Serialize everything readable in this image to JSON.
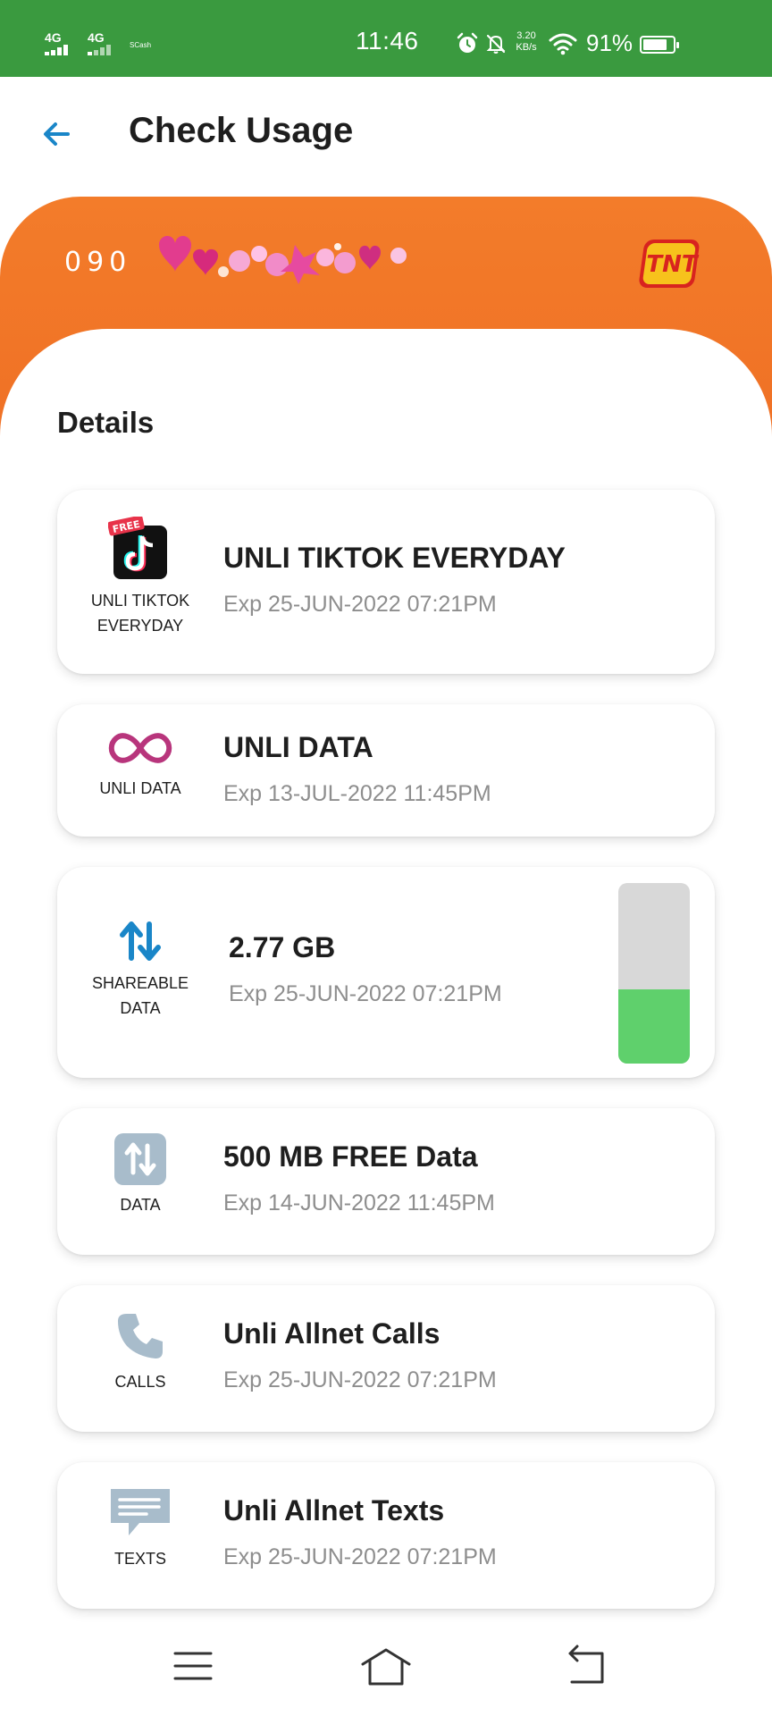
{
  "status_bar": {
    "network_1": "4G",
    "network_2": "4G",
    "carrier_tag": "SCash",
    "time": "11:46",
    "speed_value": "3.20",
    "speed_unit": "KB/s",
    "battery_percent": "91%",
    "battery_level": 0.91,
    "color": "#3a9a3f"
  },
  "header": {
    "back_icon": "arrow-left-icon",
    "title": "Check Usage"
  },
  "banner": {
    "number_prefix": "090",
    "brand_logo_text": "TNT",
    "color": "#f37c2a"
  },
  "details": {
    "title": "Details",
    "items": [
      {
        "icon": "tiktok-icon",
        "icon_badge": "FREE",
        "icon_label_line1": "UNLI TIKTOK",
        "icon_label_line2": "EVERYDAY",
        "title": "UNLI TIKTOK EVERYDAY",
        "expiry": "Exp 25-JUN-2022 07:21PM"
      },
      {
        "icon": "infinity-icon",
        "icon_label_line1": "UNLI DATA",
        "title": "UNLI DATA",
        "expiry": "Exp 13-JUL-2022 11:45PM"
      },
      {
        "icon": "shareable-data-icon",
        "icon_label_line1": "SHAREABLE",
        "icon_label_line2": "DATA",
        "title": "2.77 GB",
        "expiry": "Exp 25-JUN-2022 07:21PM",
        "remaining_fraction": 0.41,
        "bar_fill_color": "#5fd06c"
      },
      {
        "icon": "data-icon",
        "icon_label_line1": "DATA",
        "title": "500 MB FREE Data",
        "expiry": "Exp 14-JUN-2022 11:45PM"
      },
      {
        "icon": "phone-icon",
        "icon_label_line1": "CALLS",
        "title": "Unli Allnet Calls",
        "expiry": "Exp 25-JUN-2022 07:21PM"
      },
      {
        "icon": "message-icon",
        "icon_label_line1": "TEXTS",
        "title": "Unli Allnet Texts",
        "expiry": "Exp 25-JUN-2022 07:21PM"
      }
    ]
  },
  "nav_bar": {
    "menu_icon": "menu-icon",
    "home_icon": "home-icon",
    "back_icon": "back-icon"
  }
}
